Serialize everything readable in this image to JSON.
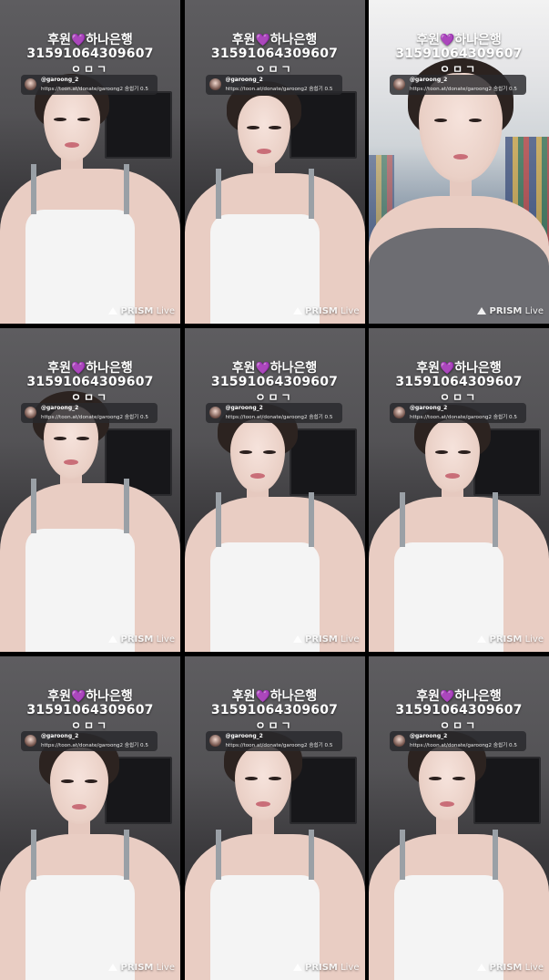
{
  "overlay": {
    "title_before": "후원",
    "title_emoji": "💜",
    "title_after": "하나은행",
    "account_number": "31591064309607",
    "initials": "ㅇㅁㄱ",
    "comment_user": "@garoong_2",
    "comment_message": "https://toon.at/donate/garoong2  숨쉽기 0.5",
    "watermark_brand": "PRISM",
    "watermark_suffix": "Live"
  },
  "frames": [
    {
      "scene": "room"
    },
    {
      "scene": "room"
    },
    {
      "scene": "store"
    },
    {
      "scene": "room"
    },
    {
      "scene": "room"
    },
    {
      "scene": "room"
    },
    {
      "scene": "room"
    },
    {
      "scene": "room"
    },
    {
      "scene": "room"
    }
  ],
  "colors": {
    "heart": "#8b3fd9",
    "overlay_text": "#ffffff",
    "comment_bg": "#28282c",
    "background": "#000000"
  }
}
